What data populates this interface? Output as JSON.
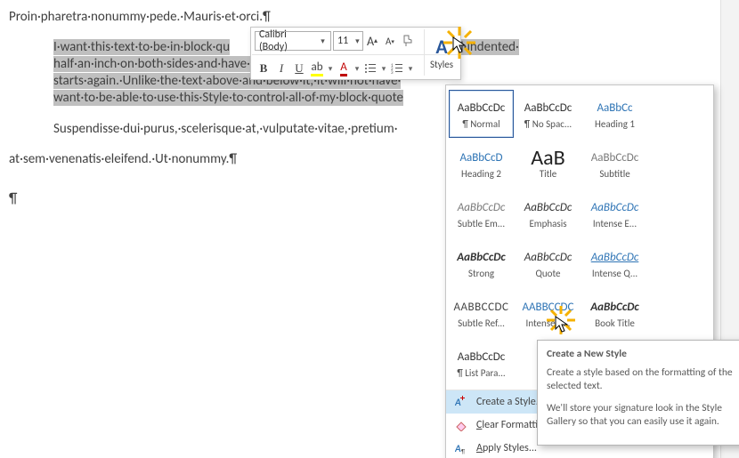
{
  "doc": {
    "line1": "Proin·pharetra·nonummy·pede.·Mauris·et·orci.¶",
    "bq1": "I·want·this·text·to·be·in·block·qu",
    "bq1b": "ed·and·indented·",
    "bq2": "half·an·inch·on·both·sides·and·have·12·points·of·space·beneath·",
    "bq3": "starts·again.·Unlike·the·text·above·and·below·it,·it·will·not·have·",
    "bq4": "want·to·be·able·to·use·this·Style·to·control·all·of·my·block·quote",
    "susp": "Suspendisse·dui·purus,·scelerisque·at,·vulputate·vitae,·pretium·",
    "atsem": "at·sem·venenatis·eleifend.·Ut·nonummy.¶",
    "lonepm": "¶"
  },
  "mini": {
    "font": "Calibri (Body)",
    "size": "11",
    "styles_label": "Styles"
  },
  "styles": [
    {
      "preview": "AaBbCcDc",
      "cls": "",
      "label": "¶ Normal",
      "sel": true
    },
    {
      "preview": "AaBbCcDc",
      "cls": "",
      "label": "¶ No Spac..."
    },
    {
      "preview": "AaBbCc",
      "cls": "blue",
      "label": "Heading 1"
    },
    {
      "preview": "AaBbCcD",
      "cls": "blue",
      "label": "Heading 2"
    },
    {
      "preview": "AaB",
      "cls": "big",
      "label": "Title"
    },
    {
      "preview": "AaBbCcDc",
      "cls": "gray",
      "label": "Subtitle"
    },
    {
      "preview": "AaBbCcDc",
      "cls": "grayital",
      "label": "Subtle Em..."
    },
    {
      "preview": "AaBbCcDc",
      "cls": "ital",
      "label": "Emphasis"
    },
    {
      "preview": "AaBbCcDc",
      "cls": "blueital",
      "label": "Intense E..."
    },
    {
      "preview": "AaBbCcDc",
      "cls": "boldital",
      "label": "Strong"
    },
    {
      "preview": "AaBbCcDc",
      "cls": "ital",
      "label": "Quote"
    },
    {
      "preview": "AaBbCcDc",
      "cls": "blueuital",
      "label": "Intense Q..."
    },
    {
      "preview": "AABBCCDC",
      "cls": "caps",
      "label": "Subtle Ref..."
    },
    {
      "preview": "AABBCCDC",
      "cls": "capsblue",
      "label": "Intense R..."
    },
    {
      "preview": "AaBbCcDc",
      "cls": "boldital",
      "label": "Book Title"
    },
    {
      "preview": "AaBbCcDc",
      "cls": "",
      "label": "¶ List Para..."
    }
  ],
  "footer": {
    "create": "Create a Style...",
    "clear": "Clear Formatting",
    "apply": "Apply Styles...",
    "create_u": "C",
    "clear_u": "C",
    "apply_u": "A"
  },
  "tooltip": {
    "title": "Create a New Style",
    "p1": "Create a style based on the formatting of the selected text.",
    "p2": "We'll store your signature look in the Style Gallery so that you can easily use it again."
  }
}
